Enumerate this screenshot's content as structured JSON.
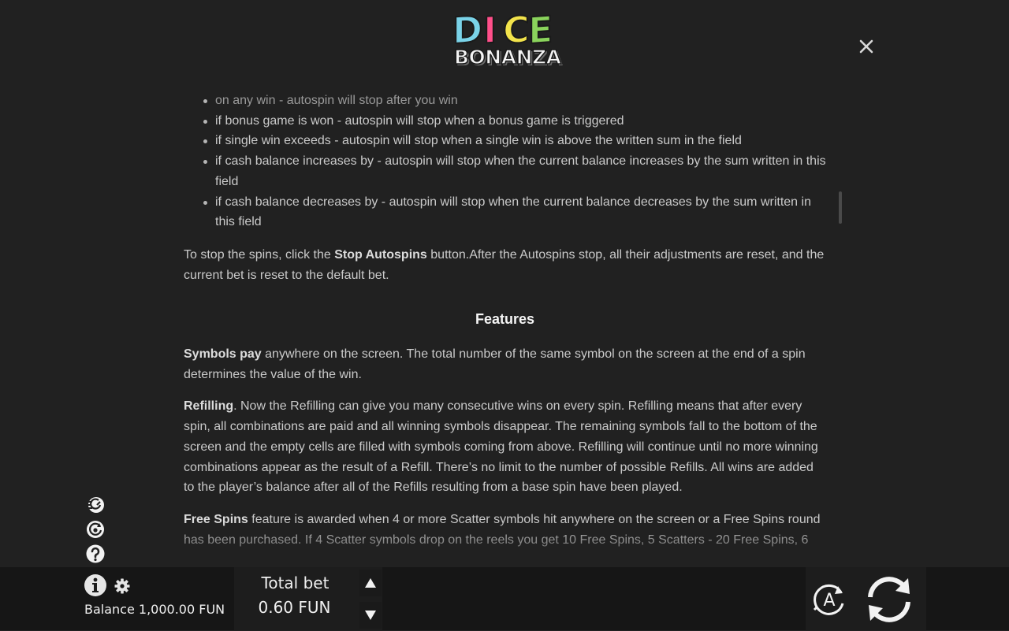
{
  "logo": {
    "line1_letters": [
      "D",
      "I",
      "C",
      "E"
    ],
    "line1_colors": [
      "#7ad3e8",
      "#ff4f8a",
      "#f2e34b",
      "#8ad35c"
    ],
    "line2": "BONANZA"
  },
  "close_icon": "close-icon",
  "rules": {
    "autospin_options": [
      "on any win - autospin will stop after you win",
      "if bonus game is won - autospin will stop when a bonus game is triggered",
      "if single win exceeds - autospin will stop when a single win is above the written sum in the field",
      "if cash balance increases by - autospin will stop when the current balance increases by the sum written in this field",
      "if cash balance decreases by - autospin will stop when the current balance decreases by the sum written in this field"
    ],
    "stop_text_before": "To stop the spins, click the ",
    "stop_bold": "Stop Autospins",
    "stop_text_after": " button.After the Autospins stop, all their adjustments are reset, and the current bet is reset to the default bet.",
    "features_title": "Features",
    "symbols_bold": "Symbols pay",
    "symbols_text": " anywhere on the screen. The total number of the same symbol on the screen at the end of a spin determines the value of the win.",
    "refilling_bold": "Refilling",
    "refilling_text": ". Now the Refilling can give you many consecutive wins on every spin. Refilling means that after every spin, all combinations are paid and all winning symbols disappear. The remaining symbols fall to the bottom of the screen and the empty cells are filled with symbols coming from above. Refilling will continue until no more winning combinations appear as the result of a Refill. There’s no limit to the number of possible Refills. All wins are added to the player’s balance after all of the Refills resulting from a base spin have been played.",
    "freespins_bold": "Free Spins",
    "freespins_text": " feature is awarded when 4 or more Scatter symbols hit anywhere on the screen or a Free Spins round has been purchased. If 4 Scatter symbols drop on the reels you get 10 Free Spins, 5 Scatters - 20 Free Spins, 6"
  },
  "side_icons": [
    "turbo-spin-icon",
    "autoplay-settings-icon",
    "help-icon"
  ],
  "bottom": {
    "balance_label": "Balance",
    "balance_value": "1,000.00 FUN",
    "balance_text": "Balance 1,000.00 FUN",
    "total_bet_label": "Total bet",
    "total_bet_value": "0.60 FUN",
    "auto_label": "A"
  },
  "colors": {
    "background": "#212121",
    "bar": "#161616",
    "text": "#cacaca"
  }
}
